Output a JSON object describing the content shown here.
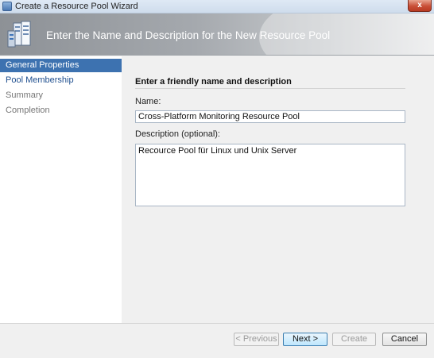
{
  "window": {
    "title": "Create a Resource Pool Wizard",
    "close_glyph": "x"
  },
  "banner": {
    "heading": "Enter the Name and Description for the New Resource Pool",
    "icon": "server-rack-icon"
  },
  "nav": {
    "items": [
      {
        "label": "General Properties",
        "state": "selected"
      },
      {
        "label": "Pool Membership",
        "state": "link"
      },
      {
        "label": "Summary",
        "state": "inactive"
      },
      {
        "label": "Completion",
        "state": "inactive"
      }
    ]
  },
  "form": {
    "section_heading": "Enter a friendly name and description",
    "name_label": "Name:",
    "name_value": "Cross-Platform Monitoring Resource Pool",
    "description_label": "Description (optional):",
    "description_value": "Recource Pool für Linux und Unix Server"
  },
  "buttons": {
    "previous": "< Previous",
    "next": "Next >",
    "create": "Create",
    "cancel": "Cancel"
  },
  "colors": {
    "nav_selected": "#3d72b0",
    "banner": "#a5a9ae",
    "close_button": "#c94f37"
  }
}
